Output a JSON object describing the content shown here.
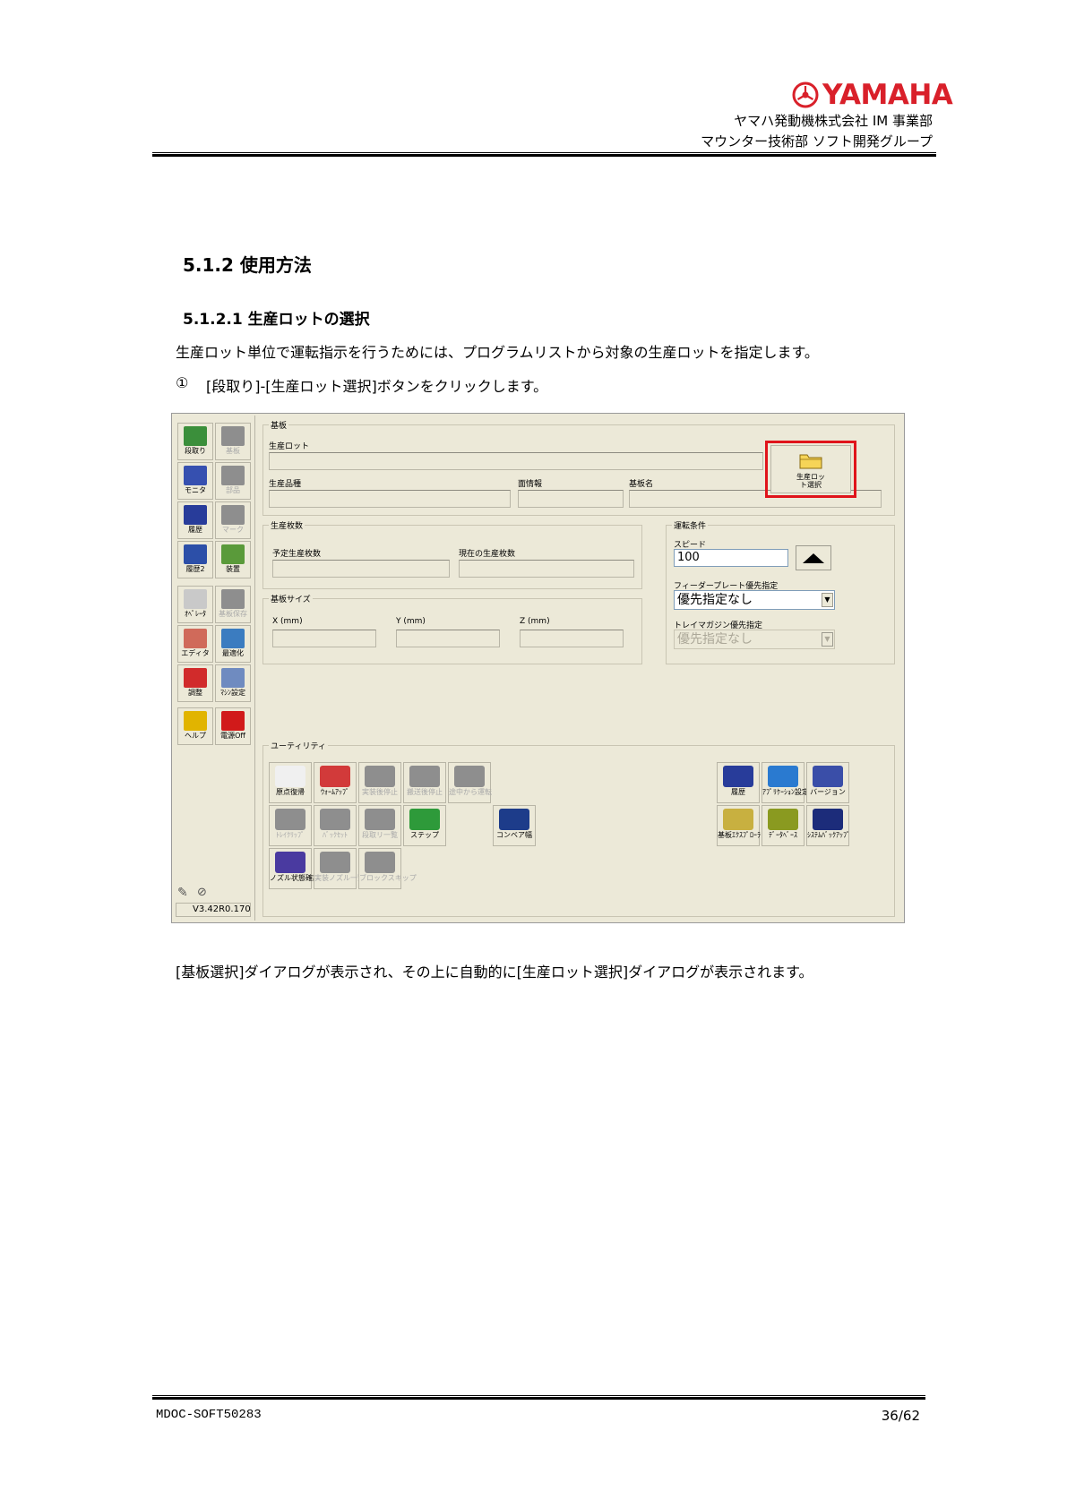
{
  "header": {
    "brand": "YAMAHA",
    "company": "ヤマハ発動機株式会社 IM 事業部",
    "department": "マウンター技術部 ソフト開発グループ"
  },
  "section_title": "5.1.2 使用方法",
  "subsection_title": "5.1.2.1 生産ロットの選択",
  "paragraph1": "生産ロット単位で運転指示を行うためには、プログラムリストから対象の生産ロットを指定します。",
  "step1_marker": "①",
  "step1": "[段取り]-[生産ロット選択]ボタンをクリックします。",
  "caption_after": "[基板選択]ダイアログが表示され、その上に自動的に[生産ロット選択]ダイアログが表示されます。",
  "app": {
    "left_toolbar": [
      {
        "label": "段取り",
        "enabled": true,
        "icon": "setup-icon"
      },
      {
        "label": "基板",
        "enabled": false,
        "icon": "board-icon"
      },
      {
        "label": "モニタ",
        "enabled": true,
        "icon": "monitor-icon"
      },
      {
        "label": "部品",
        "enabled": false,
        "icon": "parts-icon"
      },
      {
        "label": "履歴",
        "enabled": true,
        "icon": "history-icon"
      },
      {
        "label": "マーク",
        "enabled": false,
        "icon": "mark-icon"
      },
      {
        "label": "履歴2",
        "enabled": true,
        "icon": "history2-icon"
      },
      {
        "label": "装置",
        "enabled": true,
        "icon": "device-icon"
      },
      {
        "label": "ｵﾍﾟﾚｰﾀ",
        "enabled": true,
        "icon": "operator-icon"
      },
      {
        "label": "基板保存",
        "enabled": false,
        "icon": "board-save-icon"
      },
      {
        "label": "エディタ",
        "enabled": true,
        "icon": "editor-icon"
      },
      {
        "label": "最適化",
        "enabled": true,
        "icon": "optimize-icon"
      },
      {
        "label": "調整",
        "enabled": true,
        "icon": "adjust-icon"
      },
      {
        "label": "ﾏｼﾝ設定",
        "enabled": true,
        "icon": "machine-settings-icon"
      },
      {
        "label": "ヘルプ",
        "enabled": true,
        "icon": "help-icon"
      },
      {
        "label": "電源Off",
        "enabled": true,
        "icon": "power-icon"
      }
    ],
    "version": "V3.42R0.170",
    "board_group": {
      "title": "基板",
      "lot_label": "生産ロット",
      "product_label": "生産品種",
      "face_label": "面情報",
      "board_name_label": "基板名",
      "lot_button_label": "生産ロット選択"
    },
    "count_group": {
      "title": "生産枚数",
      "planned_label": "予定生産枚数",
      "current_label": "現在の生産枚数"
    },
    "size_group": {
      "title": "基板サイズ",
      "x_label": "X (mm)",
      "y_label": "Y (mm)",
      "z_label": "Z (mm)"
    },
    "run_group": {
      "title": "運転条件",
      "speed_label": "スピード",
      "speed_value": "100",
      "feeder_label": "フィーダープレート優先指定",
      "feeder_value": "優先指定なし",
      "tray_label": "トレイマガジン優先指定",
      "tray_value": "優先指定なし"
    },
    "utility_group": {
      "title": "ユーティリティ",
      "buttons": [
        {
          "label": "原点復帰",
          "enabled": true,
          "icon": "home-return-icon"
        },
        {
          "label": "ｳｫｰﾑｱｯﾌﾟ",
          "enabled": true,
          "icon": "warmup-icon"
        },
        {
          "label": "実装後停止",
          "enabled": false,
          "icon": "stop-after-mount-icon"
        },
        {
          "label": "搬送後停止",
          "enabled": false,
          "icon": "stop-after-transfer-icon"
        },
        {
          "label": "途中から運転",
          "enabled": false,
          "icon": "resume-icon"
        },
        {
          "label": "ﾄﾚｲｸﾘｯﾌﾟ",
          "enabled": false,
          "icon": "tray-clip-icon"
        },
        {
          "label": "ﾊﾞｯｸｾｯﾄ",
          "enabled": false,
          "icon": "backset-icon"
        },
        {
          "label": "段取リ一覧",
          "enabled": false,
          "icon": "setup-list-icon"
        },
        {
          "label": "ステップ",
          "enabled": true,
          "icon": "step-icon"
        },
        {
          "label": "コンベア幅",
          "enabled": true,
          "icon": "conveyor-width-icon"
        },
        {
          "label": "ノズル状態確認",
          "enabled": true,
          "icon": "nozzle-check-icon"
        },
        {
          "label": "実装ノズル一覧",
          "enabled": false,
          "icon": "nozzle-list-icon"
        },
        {
          "label": "ブロックスキップ",
          "enabled": false,
          "icon": "block-skip-icon"
        },
        {
          "label": "履歴",
          "enabled": true,
          "icon": "history-icon"
        },
        {
          "label": "ｱﾌﾟﾘｹｰｼｮﾝ設定",
          "enabled": true,
          "icon": "app-settings-icon"
        },
        {
          "label": "バージョン",
          "enabled": true,
          "icon": "version-icon"
        },
        {
          "label": "基板ｴｸｽﾌﾟﾛｰﾗ",
          "enabled": true,
          "icon": "board-explorer-icon"
        },
        {
          "label": "ﾃﾞｰﾀﾍﾞｰｽ",
          "enabled": true,
          "icon": "database-icon"
        },
        {
          "label": "ｼｽﾃﾑﾊﾞｯｸｱｯﾌﾟ",
          "enabled": true,
          "icon": "system-backup-icon"
        }
      ]
    }
  },
  "footer": {
    "doc_id": "MDOC-SOFT50283",
    "page": "36/62"
  }
}
